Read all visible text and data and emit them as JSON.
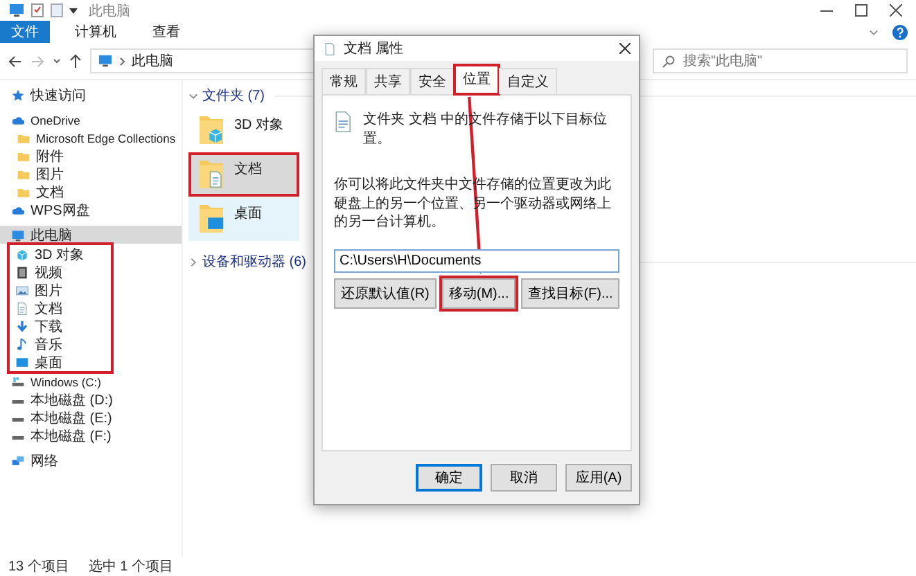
{
  "window": {
    "title": "此电脑",
    "ribbon_tabs": [
      {
        "label": "文件",
        "kind": "file"
      },
      {
        "label": "计算机",
        "kind": "tab"
      },
      {
        "label": "查看",
        "kind": "tab"
      }
    ],
    "address": {
      "path": "此电脑"
    },
    "search": {
      "placeholder": "搜索\"此电脑\""
    }
  },
  "sidebar": {
    "items": [
      {
        "label": "快速访问",
        "kind": "star",
        "selected": false
      },
      {
        "label": "OneDrive",
        "kind": "cloud",
        "selected": false,
        "children": [
          {
            "label": "Microsoft Edge Collections",
            "kind": "folder",
            "selected": false
          },
          {
            "label": "附件",
            "kind": "folder",
            "selected": false
          },
          {
            "label": "图片",
            "kind": "folder",
            "selected": false
          },
          {
            "label": "文档",
            "kind": "folder",
            "selected": false
          }
        ]
      },
      {
        "label": "WPS网盘",
        "kind": "cloud",
        "selected": false
      },
      {
        "label": "此电脑",
        "kind": "pc",
        "selected": true,
        "children_highlighted": true,
        "children": [
          {
            "label": "3D 对象",
            "kind": "cube",
            "selected": false
          },
          {
            "label": "视频",
            "kind": "film",
            "selected": false
          },
          {
            "label": "图片",
            "kind": "picture",
            "selected": false
          },
          {
            "label": "文档",
            "kind": "document",
            "selected": false
          },
          {
            "label": "下载",
            "kind": "download",
            "selected": false
          },
          {
            "label": "音乐",
            "kind": "music",
            "selected": false
          },
          {
            "label": "桌面",
            "kind": "desktop",
            "selected": false
          }
        ]
      },
      {
        "label": "Windows (C:)",
        "kind": "windrive",
        "selected": false
      },
      {
        "label": "本地磁盘 (D:)",
        "kind": "drive",
        "selected": false
      },
      {
        "label": "本地磁盘 (E:)",
        "kind": "drive",
        "selected": false
      },
      {
        "label": "本地磁盘 (F:)",
        "kind": "drive",
        "selected": false
      },
      {
        "label": "网络",
        "kind": "network",
        "selected": false
      }
    ]
  },
  "content": {
    "groups": [
      {
        "label": "文件夹 (7)",
        "expanded": true,
        "items": [
          {
            "label": "3D 对象",
            "kind": "cube",
            "selected": false,
            "hovered": false,
            "highlighted": false
          },
          {
            "label": "文档",
            "kind": "document",
            "selected": true,
            "hovered": false,
            "highlighted": true
          },
          {
            "label": "桌面",
            "kind": "desktop",
            "selected": false,
            "hovered": true,
            "highlighted": false
          }
        ]
      },
      {
        "label": "设备和驱动器 (6)",
        "expanded": false
      }
    ]
  },
  "status_bar": {
    "count": "13 个项目",
    "selection": "选中 1 个项目"
  },
  "dialog": {
    "title": "文档 属性",
    "tabs": [
      {
        "label": "常规",
        "selected": false,
        "highlighted": false
      },
      {
        "label": "共享",
        "selected": false,
        "highlighted": false
      },
      {
        "label": "安全",
        "selected": false,
        "highlighted": false
      },
      {
        "label": "位置",
        "selected": true,
        "highlighted": true
      },
      {
        "label": "自定义",
        "selected": false,
        "highlighted": false
      }
    ],
    "location_note": "文件夹 文档 中的文件存储于以下目标位置。",
    "description": "你可以将此文件夹中文件存储的位置更改为此硬盘上的另一个位置、另一个驱动器或网络上的另一台计算机。",
    "path": "C:\\Users\\H\\Documents",
    "actions": [
      {
        "label": "还原默认值(R)",
        "highlighted": false
      },
      {
        "label": "移动(M)...",
        "highlighted": true
      },
      {
        "label": "查找目标(F)...",
        "highlighted": false
      }
    ],
    "buttons": [
      {
        "label": "确定",
        "default": true
      },
      {
        "label": "取消",
        "default": false
      },
      {
        "label": "应用(A)",
        "default": false
      }
    ]
  }
}
